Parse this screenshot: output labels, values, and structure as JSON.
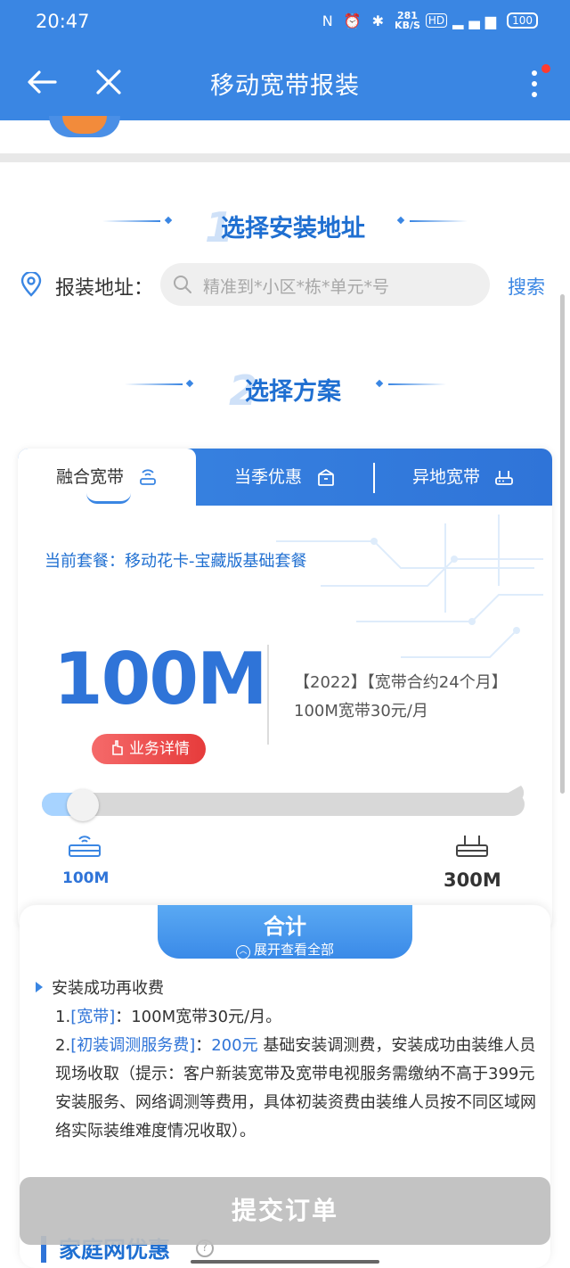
{
  "status_bar": {
    "time": "20:47",
    "net_speed_value": "281",
    "net_speed_unit": "KB/S",
    "battery": "100"
  },
  "nav": {
    "title": "移动宽带报装"
  },
  "step1": {
    "num": "1",
    "title": "选择安装地址"
  },
  "address": {
    "label": "报装地址：",
    "placeholder": "精准到*小区*栋*单元*号",
    "search_label": "搜索"
  },
  "step2": {
    "num": "2",
    "title": "选择方案"
  },
  "tabs": [
    {
      "label": "融合宽带"
    },
    {
      "label": "当季优惠"
    },
    {
      "label": "异地宽带"
    }
  ],
  "plan": {
    "current_label": "当前套餐：移动花卡-宝藏版基础套餐",
    "speed": "100M",
    "description": "【2022】【宽带合约24个月】100M宽带30元/月",
    "detail_button": "业务详情"
  },
  "slider": {
    "min_label": "100M",
    "max_label": "300M",
    "level": 0
  },
  "summary": {
    "title": "合计",
    "expand_label": "展开查看全部",
    "section_title": "安装成功再收费",
    "item1_prefix": "1.",
    "item1_tag": "[宽带]",
    "item1_text": "：100M宽带30元/月。",
    "item2_prefix": "2.",
    "item2_tag": "[初装调测服务费]",
    "item2_sep": "：",
    "item2_price": "200元",
    "item2_text": " 基础安装调测费，安装成功由装维人员现场收取（提示：客户新装宽带及宽带电视服务需缴纳不高于399元安装服务、网络调测等费用，具体初装资费由装维人员按不同区域网络实际装维难度情况收取）。"
  },
  "submit_label": "提交订单",
  "next_section_title": "家庭网优惠",
  "colors": {
    "primary": "#3a86e3",
    "accent_red": "#e63b3b"
  }
}
